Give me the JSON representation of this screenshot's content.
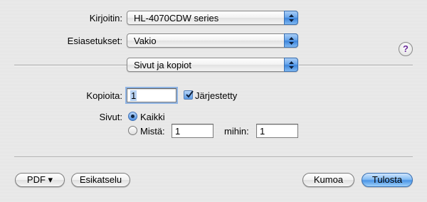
{
  "printer": {
    "label": "Kirjoitin:",
    "value": "HL-4070CDW series"
  },
  "presets": {
    "label": "Esiasetukset:",
    "value": "Vakio"
  },
  "help": {
    "glyph": "?"
  },
  "panel_menu": {
    "value": "Sivut ja kopiot"
  },
  "copies": {
    "label": "Kopioita:",
    "value": "1",
    "collated_label": "Järjestetty",
    "collated": true
  },
  "pages": {
    "label": "Sivut:",
    "all_label": "Kaikki",
    "all_selected": true,
    "from_label": "Mistä:",
    "from_value": "1",
    "to_label": "mihin:",
    "to_value": "1"
  },
  "footer": {
    "pdf_label": "PDF ▾",
    "preview_label": "Esikatselu",
    "cancel_label": "Kumoa",
    "print_label": "Tulosta"
  },
  "colors": {
    "accent": "#4b95e6",
    "help": "#6a2a9a"
  }
}
